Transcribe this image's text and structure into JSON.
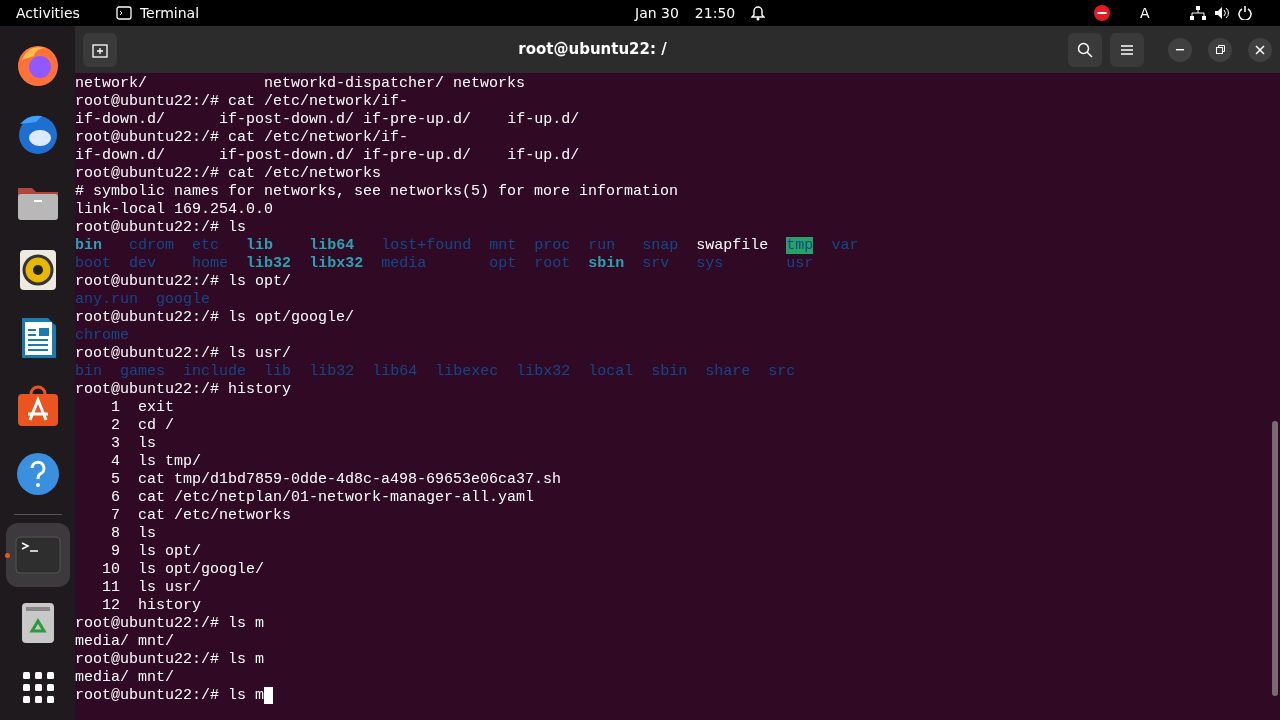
{
  "top_bar": {
    "activities": "Activities",
    "app_name": "Terminal",
    "date": "Jan 30",
    "time": "21:50",
    "keyboard_layout": "A"
  },
  "dock": {
    "items": [
      {
        "kind": "firefox",
        "running": false
      },
      {
        "kind": "mail",
        "running": false
      },
      {
        "kind": "files",
        "running": false
      },
      {
        "kind": "music",
        "running": false
      },
      {
        "kind": "writer",
        "running": false
      },
      {
        "kind": "store",
        "running": false
      },
      {
        "kind": "help",
        "running": false
      },
      {
        "kind": "terminal",
        "running": true
      },
      {
        "kind": "trash",
        "running": false
      }
    ]
  },
  "window": {
    "title": "root@ubuntu22: /"
  },
  "terminal": {
    "lines": [
      {
        "kind": "completion",
        "rows": [
          [
            {
              "name": "network/",
              "kind": "plain"
            },
            {
              "name": "networkd-dispatcher/",
              "kind": "plain"
            },
            {
              "name": "networks",
              "kind": "plain"
            }
          ]
        ]
      },
      {
        "kind": "prompt",
        "prompt": "root@ubuntu22:/#",
        "command": "cat /etc/network/if-"
      },
      {
        "kind": "completion",
        "rows": [
          [
            {
              "name": "if-down.d/",
              "kind": "plain"
            },
            {
              "name": "if-post-down.d/",
              "kind": "plain"
            },
            {
              "name": "if-pre-up.d/",
              "kind": "plain"
            },
            {
              "name": "if-up.d/",
              "kind": "plain"
            }
          ]
        ]
      },
      {
        "kind": "prompt",
        "prompt": "root@ubuntu22:/#",
        "command": "cat /etc/network/if-"
      },
      {
        "kind": "completion",
        "rows": [
          [
            {
              "name": "if-down.d/",
              "kind": "plain"
            },
            {
              "name": "if-post-down.d/",
              "kind": "plain"
            },
            {
              "name": "if-pre-up.d/",
              "kind": "plain"
            },
            {
              "name": "if-up.d/",
              "kind": "plain"
            }
          ]
        ]
      },
      {
        "kind": "prompt",
        "prompt": "root@ubuntu22:/#",
        "command": "cat /etc/networks"
      },
      {
        "kind": "output",
        "text": "# symbolic names for networks, see networks(5) for more information"
      },
      {
        "kind": "output",
        "text": "link-local 169.254.0.0"
      },
      {
        "kind": "prompt",
        "prompt": "root@ubuntu22:/#",
        "command": "ls"
      },
      {
        "kind": "ls",
        "rows": [
          [
            {
              "name": "bin",
              "kind": "link"
            },
            {
              "name": "cdrom",
              "kind": "dir"
            },
            {
              "name": "etc",
              "kind": "dir"
            },
            {
              "name": "lib",
              "kind": "link"
            },
            {
              "name": "lib64",
              "kind": "link"
            },
            {
              "name": "lost+found",
              "kind": "dir"
            },
            {
              "name": "mnt",
              "kind": "dir"
            },
            {
              "name": "proc",
              "kind": "dir"
            },
            {
              "name": "run",
              "kind": "dir"
            },
            {
              "name": "snap",
              "kind": "dir"
            },
            {
              "name": "swapfile",
              "kind": "plain"
            },
            {
              "name": "tmp",
              "kind": "sticky"
            },
            {
              "name": "var",
              "kind": "dir"
            }
          ],
          [
            {
              "name": "boot",
              "kind": "dir"
            },
            {
              "name": "dev",
              "kind": "dir"
            },
            {
              "name": "home",
              "kind": "dir"
            },
            {
              "name": "lib32",
              "kind": "link"
            },
            {
              "name": "libx32",
              "kind": "link"
            },
            {
              "name": "media",
              "kind": "dir"
            },
            {
              "name": "opt",
              "kind": "dir"
            },
            {
              "name": "root",
              "kind": "dir"
            },
            {
              "name": "sbin",
              "kind": "link"
            },
            {
              "name": "srv",
              "kind": "dir"
            },
            {
              "name": "sys",
              "kind": "dir"
            },
            {
              "name": "usr",
              "kind": "dir"
            }
          ]
        ]
      },
      {
        "kind": "prompt",
        "prompt": "root@ubuntu22:/#",
        "command": "ls opt/"
      },
      {
        "kind": "ls",
        "rows": [
          [
            {
              "name": "any.run",
              "kind": "dir"
            },
            {
              "name": "google",
              "kind": "dir"
            }
          ]
        ]
      },
      {
        "kind": "prompt",
        "prompt": "root@ubuntu22:/#",
        "command": "ls opt/google/"
      },
      {
        "kind": "ls",
        "rows": [
          [
            {
              "name": "chrome",
              "kind": "dir"
            }
          ]
        ]
      },
      {
        "kind": "prompt",
        "prompt": "root@ubuntu22:/#",
        "command": "ls usr/"
      },
      {
        "kind": "ls",
        "rows": [
          [
            {
              "name": "bin",
              "kind": "dir"
            },
            {
              "name": "games",
              "kind": "dir"
            },
            {
              "name": "include",
              "kind": "dir"
            },
            {
              "name": "lib",
              "kind": "dir"
            },
            {
              "name": "lib32",
              "kind": "dir"
            },
            {
              "name": "lib64",
              "kind": "dir"
            },
            {
              "name": "libexec",
              "kind": "dir"
            },
            {
              "name": "libx32",
              "kind": "dir"
            },
            {
              "name": "local",
              "kind": "dir"
            },
            {
              "name": "sbin",
              "kind": "dir"
            },
            {
              "name": "share",
              "kind": "dir"
            },
            {
              "name": "src",
              "kind": "dir"
            }
          ]
        ]
      },
      {
        "kind": "prompt",
        "prompt": "root@ubuntu22:/#",
        "command": "history"
      },
      {
        "kind": "history",
        "number": "1",
        "command": "exit"
      },
      {
        "kind": "history",
        "number": "2",
        "command": "cd /"
      },
      {
        "kind": "history",
        "number": "3",
        "command": "ls"
      },
      {
        "kind": "history",
        "number": "4",
        "command": "ls tmp/"
      },
      {
        "kind": "history",
        "number": "5",
        "command": "cat tmp/d1bd7859-0dde-4d8c-a498-69653e06ca37.sh"
      },
      {
        "kind": "history",
        "number": "6",
        "command": "cat /etc/netplan/01-network-manager-all.yaml"
      },
      {
        "kind": "history",
        "number": "7",
        "command": "cat /etc/networks"
      },
      {
        "kind": "history",
        "number": "8",
        "command": "ls"
      },
      {
        "kind": "history",
        "number": "9",
        "command": "ls opt/"
      },
      {
        "kind": "history",
        "number": "10",
        "command": "ls opt/google/"
      },
      {
        "kind": "history",
        "number": "11",
        "command": "ls usr/"
      },
      {
        "kind": "history",
        "number": "12",
        "command": "history"
      },
      {
        "kind": "prompt",
        "prompt": "root@ubuntu22:/#",
        "command": "ls m"
      },
      {
        "kind": "completion",
        "rows": [
          [
            {
              "name": "media/",
              "kind": "plain"
            },
            {
              "name": "mnt/",
              "kind": "plain"
            }
          ]
        ]
      },
      {
        "kind": "prompt",
        "prompt": "root@ubuntu22:/#",
        "command": "ls m"
      },
      {
        "kind": "completion",
        "rows": [
          [
            {
              "name": "media/",
              "kind": "plain"
            },
            {
              "name": "mnt/",
              "kind": "plain"
            }
          ]
        ]
      },
      {
        "kind": "prompt",
        "prompt": "root@ubuntu22:/#",
        "command": "ls m",
        "cursor": true
      }
    ]
  }
}
